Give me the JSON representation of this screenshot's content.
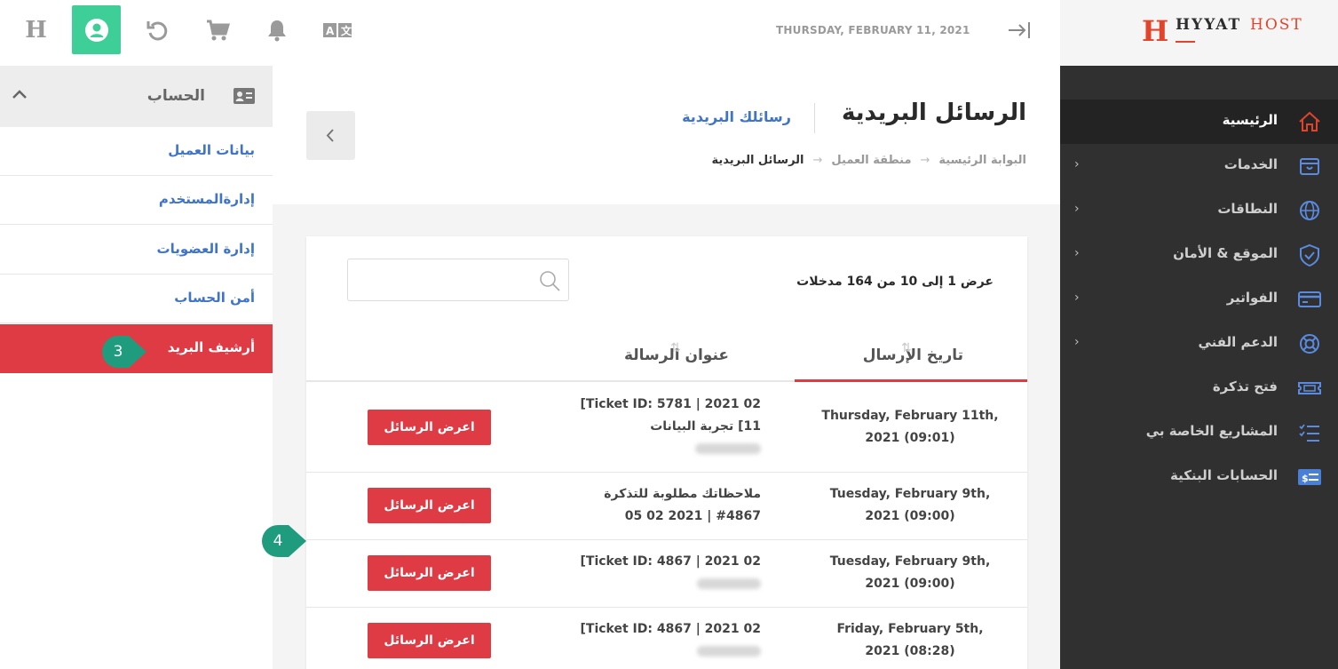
{
  "brand": {
    "logo_letter": "H",
    "name_part1": "HYYAT",
    "name_part2": "HOST"
  },
  "topbar": {
    "date": "THURSDAY, FEBRUARY 11, 2021",
    "buttons": [
      "home-h",
      "account",
      "refresh",
      "cart",
      "notifications",
      "language"
    ],
    "home_letter": "H",
    "accent_color": "#3ecf98"
  },
  "sidebar": {
    "items": [
      {
        "label": "الرئيسية",
        "icon": "home-icon",
        "active": true,
        "has_submenu": false
      },
      {
        "label": "الخدمات",
        "icon": "box-icon",
        "has_submenu": true
      },
      {
        "label": "النطاقات",
        "icon": "globe-icon",
        "has_submenu": true
      },
      {
        "label": "الموقع & الأمان",
        "icon": "shield-icon",
        "has_submenu": true
      },
      {
        "label": "الفواتير",
        "icon": "credit-card-icon",
        "has_submenu": true
      },
      {
        "label": "الدعم الفني",
        "icon": "lifebuoy-icon",
        "has_submenu": true
      },
      {
        "label": "فتح تذكرة",
        "icon": "ticket-icon",
        "has_submenu": false
      },
      {
        "label": "المشاريع الخاصة بي",
        "icon": "checklist-icon",
        "has_submenu": false
      },
      {
        "label": "الحسابات البنكية",
        "icon": "bank-card-icon",
        "has_submenu": false
      }
    ],
    "chevron": "›"
  },
  "account_panel": {
    "title": "الحساب",
    "items": [
      {
        "label": "بيانات العميل"
      },
      {
        "label": "إدارةالمستخدم"
      },
      {
        "label": "إدارة العضويات"
      },
      {
        "label": "أمن الحساب"
      },
      {
        "label": "أرشيف البريد",
        "active": true
      }
    ]
  },
  "markers": [
    "3",
    "4"
  ],
  "page": {
    "title": "الرسائل البريدية",
    "subtitle": "رسائلك البريدية",
    "breadcrumbs": [
      "البوابة الرئيسية",
      "منطقة العميل",
      "الرسائل البريدية"
    ],
    "breadcrumb_sep": "→"
  },
  "table": {
    "info": "عرض 1 إلى 10 من 164 مدخلات",
    "search_placeholder": "",
    "columns": {
      "date": "تاريخ الإرسال",
      "subject": "عنوان الرسالة"
    },
    "sort_glyph": "⇅",
    "view_label": "اعرض الرسائل",
    "rows": [
      {
        "date_line1": "Thursday, February 11th,",
        "date_line2": "2021 (09:01)",
        "subj_line1": "Ticket ID: 5781 | 2021 02]",
        "subj_line2": "11] تجربة البيانات"
      },
      {
        "date_line1": "Tuesday, February 9th,",
        "date_line2": "2021 (09:00)",
        "subj_line1": "ملاحظاتك مطلوبة للتذكرة",
        "subj_line2": "#4867 | 2021 02 05"
      },
      {
        "date_line1": "Tuesday, February 9th,",
        "date_line2": "2021 (09:00)",
        "subj_line1": "Ticket ID: 4867 | 2021 02]",
        "subj_line2": ""
      },
      {
        "date_line1": "Friday, February 5th,",
        "date_line2": "2021 (08:28)",
        "subj_line1": "Ticket ID: 4867 | 2021 02]",
        "subj_line2": ""
      }
    ]
  },
  "colors": {
    "sidebar_bg": "#303030",
    "danger": "#df3b45",
    "link": "#3f74c8",
    "marker": "#1f9b7e"
  }
}
